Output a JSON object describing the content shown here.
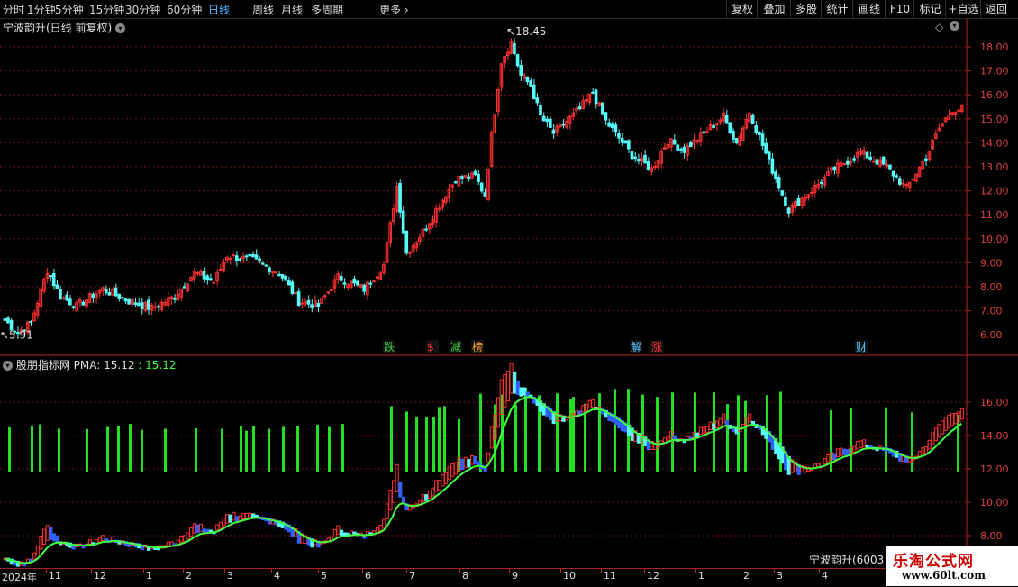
{
  "toolbar": {
    "periods": [
      "分时",
      "1分钟",
      "5分钟",
      "15分钟",
      "30分钟",
      "60分钟",
      "日线",
      "周线",
      "月线",
      "多周期",
      "更多"
    ],
    "active_period": "日线",
    "right_buttons": [
      "复权",
      "叠加",
      "多股",
      "统计",
      "画线",
      "F10",
      "标记",
      "+自选",
      "返回"
    ]
  },
  "main_chart": {
    "title": "宁波韵升(日线 前复权)",
    "high_label": "18.45",
    "low_label": "5.91",
    "yticks": [
      "18.00",
      "17.00",
      "16.00",
      "15.00",
      "14.00",
      "13.00",
      "12.00",
      "11.00",
      "10.00",
      "9.00",
      "8.00",
      "7.00",
      "6.00"
    ],
    "event_markers": [
      {
        "text": "跌",
        "color": "#3fd13f"
      },
      {
        "text": "$",
        "color": "#ff3333"
      },
      {
        "text": "减",
        "color": "#3fd13f"
      },
      {
        "text": "榜",
        "color": "#ffaa33"
      },
      {
        "text": "解",
        "color": "#55c8ff"
      },
      {
        "text": "涨",
        "color": "#ff3333"
      },
      {
        "text": "财",
        "color": "#55c8ff"
      }
    ]
  },
  "indicator": {
    "name": "股朋指标网",
    "pma_label": "PMA: 15.12",
    "pma_value": ": 15.12",
    "yticks": [
      "16.00",
      "14.00",
      "12.00",
      "10.00",
      "8.00"
    ]
  },
  "xaxis": {
    "labels": [
      "2024年",
      "11",
      "12",
      "1",
      "2",
      "3",
      "4",
      "5",
      "6",
      "7",
      "8",
      "9",
      "10",
      "11",
      "12",
      "1",
      "2",
      "3",
      "4"
    ]
  },
  "stock_tag": "宁波韵升(6003",
  "watermark": {
    "title": "乐淘公式网",
    "url": "www.60lt.com"
  },
  "colors": {
    "up": "#ff3232",
    "down": "#54fcfc",
    "ma": "#3fff3f",
    "grid": "#7a1010",
    "volbar": "#22e022"
  },
  "chart_data": {
    "type": "candlestick",
    "price_max": 18.45,
    "price_min": 5.91,
    "close_path": [
      [
        0,
        6.6
      ],
      [
        4,
        6.1
      ],
      [
        8,
        6.5
      ],
      [
        13,
        8.7
      ],
      [
        17,
        7.6
      ],
      [
        22,
        7.2
      ],
      [
        30,
        7.9
      ],
      [
        38,
        7.4
      ],
      [
        45,
        7.1
      ],
      [
        52,
        7.6
      ],
      [
        58,
        8.6
      ],
      [
        64,
        8.2
      ],
      [
        68,
        9.3
      ],
      [
        76,
        9.1
      ],
      [
        84,
        8.6
      ],
      [
        90,
        7.4
      ],
      [
        96,
        7.2
      ],
      [
        102,
        8.4
      ],
      [
        110,
        7.9
      ],
      [
        116,
        8.9
      ],
      [
        120,
        12.2
      ],
      [
        123,
        9.4
      ],
      [
        128,
        10.3
      ],
      [
        132,
        11.2
      ],
      [
        138,
        12.5
      ],
      [
        144,
        12.6
      ],
      [
        147,
        11.8
      ],
      [
        149,
        14.3
      ],
      [
        152,
        17.4
      ],
      [
        155,
        18.2
      ],
      [
        158,
        16.8
      ],
      [
        161,
        16.4
      ],
      [
        164,
        15.1
      ],
      [
        168,
        14.4
      ],
      [
        176,
        15.4
      ],
      [
        180,
        16.1
      ],
      [
        184,
        14.9
      ],
      [
        192,
        13.5
      ],
      [
        198,
        12.9
      ],
      [
        203,
        14.1
      ],
      [
        208,
        13.7
      ],
      [
        214,
        14.4
      ],
      [
        220,
        15.1
      ],
      [
        224,
        14.0
      ],
      [
        228,
        15.3
      ],
      [
        234,
        13.2
      ],
      [
        240,
        11.2
      ],
      [
        246,
        11.9
      ],
      [
        254,
        12.9
      ],
      [
        262,
        13.6
      ],
      [
        270,
        13.0
      ],
      [
        276,
        12.1
      ],
      [
        282,
        13.4
      ],
      [
        286,
        14.6
      ],
      [
        290,
        15.4
      ]
    ]
  }
}
